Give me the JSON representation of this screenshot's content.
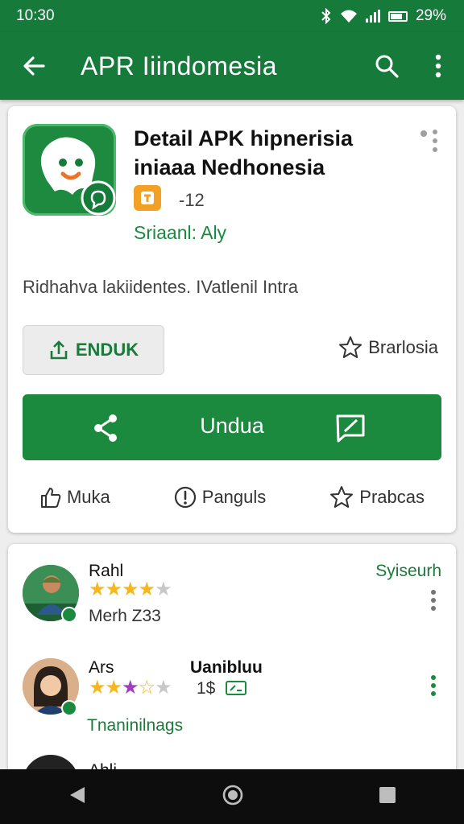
{
  "status_bar": {
    "time": "10:30",
    "battery": "29%"
  },
  "app_bar": {
    "title": "APR Iiindomesia"
  },
  "app": {
    "name": "Detail APK hipnerisia iniaaa Nedhonesia",
    "badge_text": "-12",
    "publisher": "Sriaanl: Aly",
    "description": "Ridhahva lakiidentes. IVatlenil Intra"
  },
  "buttons": {
    "enduk_label": "ENDUK",
    "wishlist_label": "Brarlosia",
    "primary_label": "Undua"
  },
  "actions": [
    {
      "label": "Muka"
    },
    {
      "label": "Panguls"
    },
    {
      "label": "Prabcas"
    }
  ],
  "reviews": [
    {
      "name": "Rahl",
      "subtitle": "Merh Z33",
      "right": "Syiseurh",
      "rating": 4
    },
    {
      "name": "Ars",
      "extra_name": "Uanibluu",
      "price": "1$",
      "subtitle": "Tnaninilnags",
      "rating": 3.5
    },
    {
      "name": "Ahli"
    }
  ],
  "colors": {
    "brand_green": "#157a3a",
    "button_green": "#1b8a3e",
    "star_gold": "#f5b71d",
    "badge_orange": "#f2a125"
  }
}
